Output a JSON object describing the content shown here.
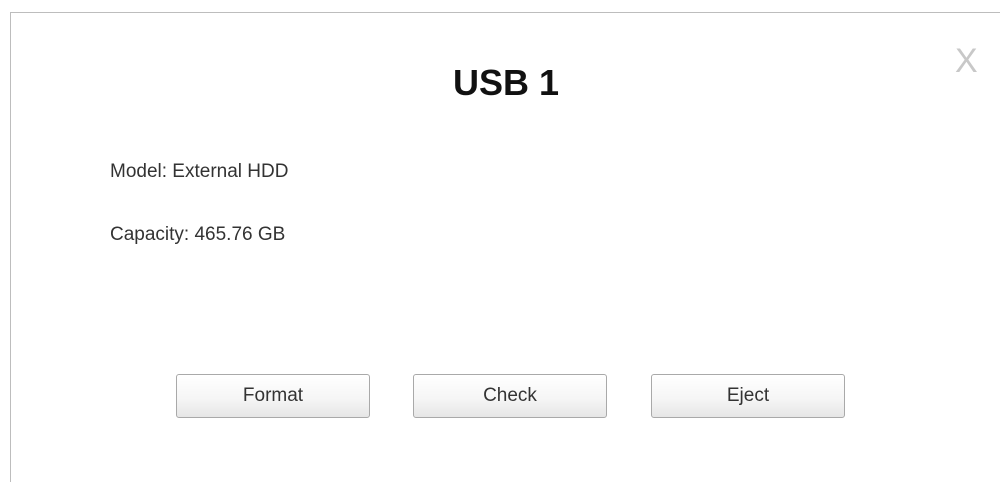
{
  "dialog": {
    "title": "USB 1",
    "close_label": "X",
    "model_text": "Model: External HDD",
    "capacity_text": "Capacity: 465.76 GB",
    "buttons": {
      "format": "Format",
      "check": "Check",
      "eject": "Eject"
    }
  }
}
